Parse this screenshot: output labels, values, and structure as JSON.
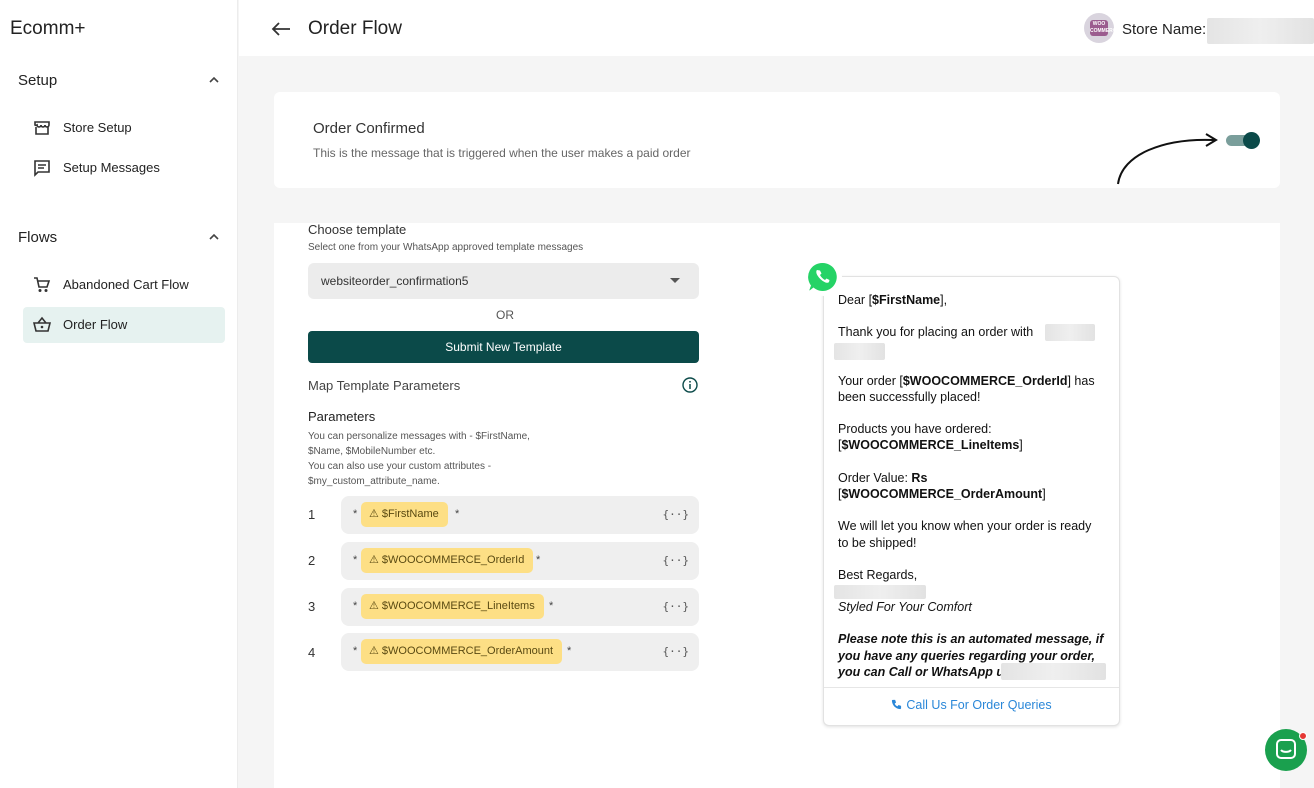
{
  "sidebar": {
    "brand": "Ecomm+",
    "sections": [
      {
        "title": "Setup",
        "items": [
          {
            "label": "Store Setup",
            "icon": "store-icon"
          },
          {
            "label": "Setup Messages",
            "icon": "message-icon"
          }
        ]
      },
      {
        "title": "Flows",
        "items": [
          {
            "label": "Abandoned Cart Flow",
            "icon": "cart-icon"
          },
          {
            "label": "Order Flow",
            "icon": "basket-icon",
            "active": true
          }
        ]
      }
    ]
  },
  "header": {
    "title": "Order Flow",
    "store_label": "Store Name:",
    "avatar_text": "WOO COMMERCE"
  },
  "order_confirmed": {
    "title": "Order Confirmed",
    "description": "This is the message that is triggered when the user makes a paid order",
    "toggle_on": true
  },
  "template": {
    "title": "Choose template",
    "subtitle": "Select one from your WhatsApp approved template messages",
    "selected": "websiteorder_confirmation5",
    "or_text": "OR",
    "submit_label": "Submit New Template"
  },
  "mapping": {
    "title": "Map Template Parameters",
    "params_title": "Parameters",
    "params_desc": [
      "You can personalize messages with - $FirstName,",
      "$Name, $MobileNumber etc.",
      "You can also use your custom attributes -",
      "$my_custom_attribute_name."
    ],
    "params": [
      {
        "num": "1",
        "chip": "⚠ $FirstName"
      },
      {
        "num": "2",
        "chip": "⚠ $WOOCOMMERCE_OrderId"
      },
      {
        "num": "3",
        "chip": "⚠ $WOOCOMMERCE_LineItems"
      },
      {
        "num": "4",
        "chip": "⚠ $WOOCOMMERCE_OrderAmount"
      }
    ],
    "star": "*",
    "vars_icon": "{··}"
  },
  "preview": {
    "greeting_pre": "Dear [",
    "greeting_var": "$FirstName",
    "greeting_post": "],",
    "thanks": "Thank you for placing an order with",
    "order_pre": "Your order [",
    "order_var": "$WOOCOMMERCE_OrderId",
    "order_post": "] has",
    "order_line2": "been successfully placed!",
    "products_line1": "Products you have ordered:",
    "products_pre": "[",
    "products_var": "$WOOCOMMERCE_LineItems",
    "products_post": "]",
    "value_pre": "Order Value: ",
    "value_bold": "Rs",
    "value_line2_pre": "[",
    "value_var": "$WOOCOMMERCE_OrderAmount",
    "value_line2_post": "]",
    "ready_line1": "We will let you know when your order is ready",
    "ready_line2": "to be shipped!",
    "regards": "Best Regards,",
    "tagline": "Styled For Your Comfort",
    "note_line1": "Please note this is an automated message, if",
    "note_line2": "you have any queries regarding your order,",
    "note_line3": "you can Call or WhatsApp us on",
    "call_label": "Call Us For Order Queries"
  },
  "colors": {
    "primary": "#0b4a49",
    "active_nav": "#e6f2f0",
    "chip": "#fddf85",
    "link": "#2a87d8",
    "whatsapp": "#25d366",
    "chat": "#1aa04e"
  }
}
